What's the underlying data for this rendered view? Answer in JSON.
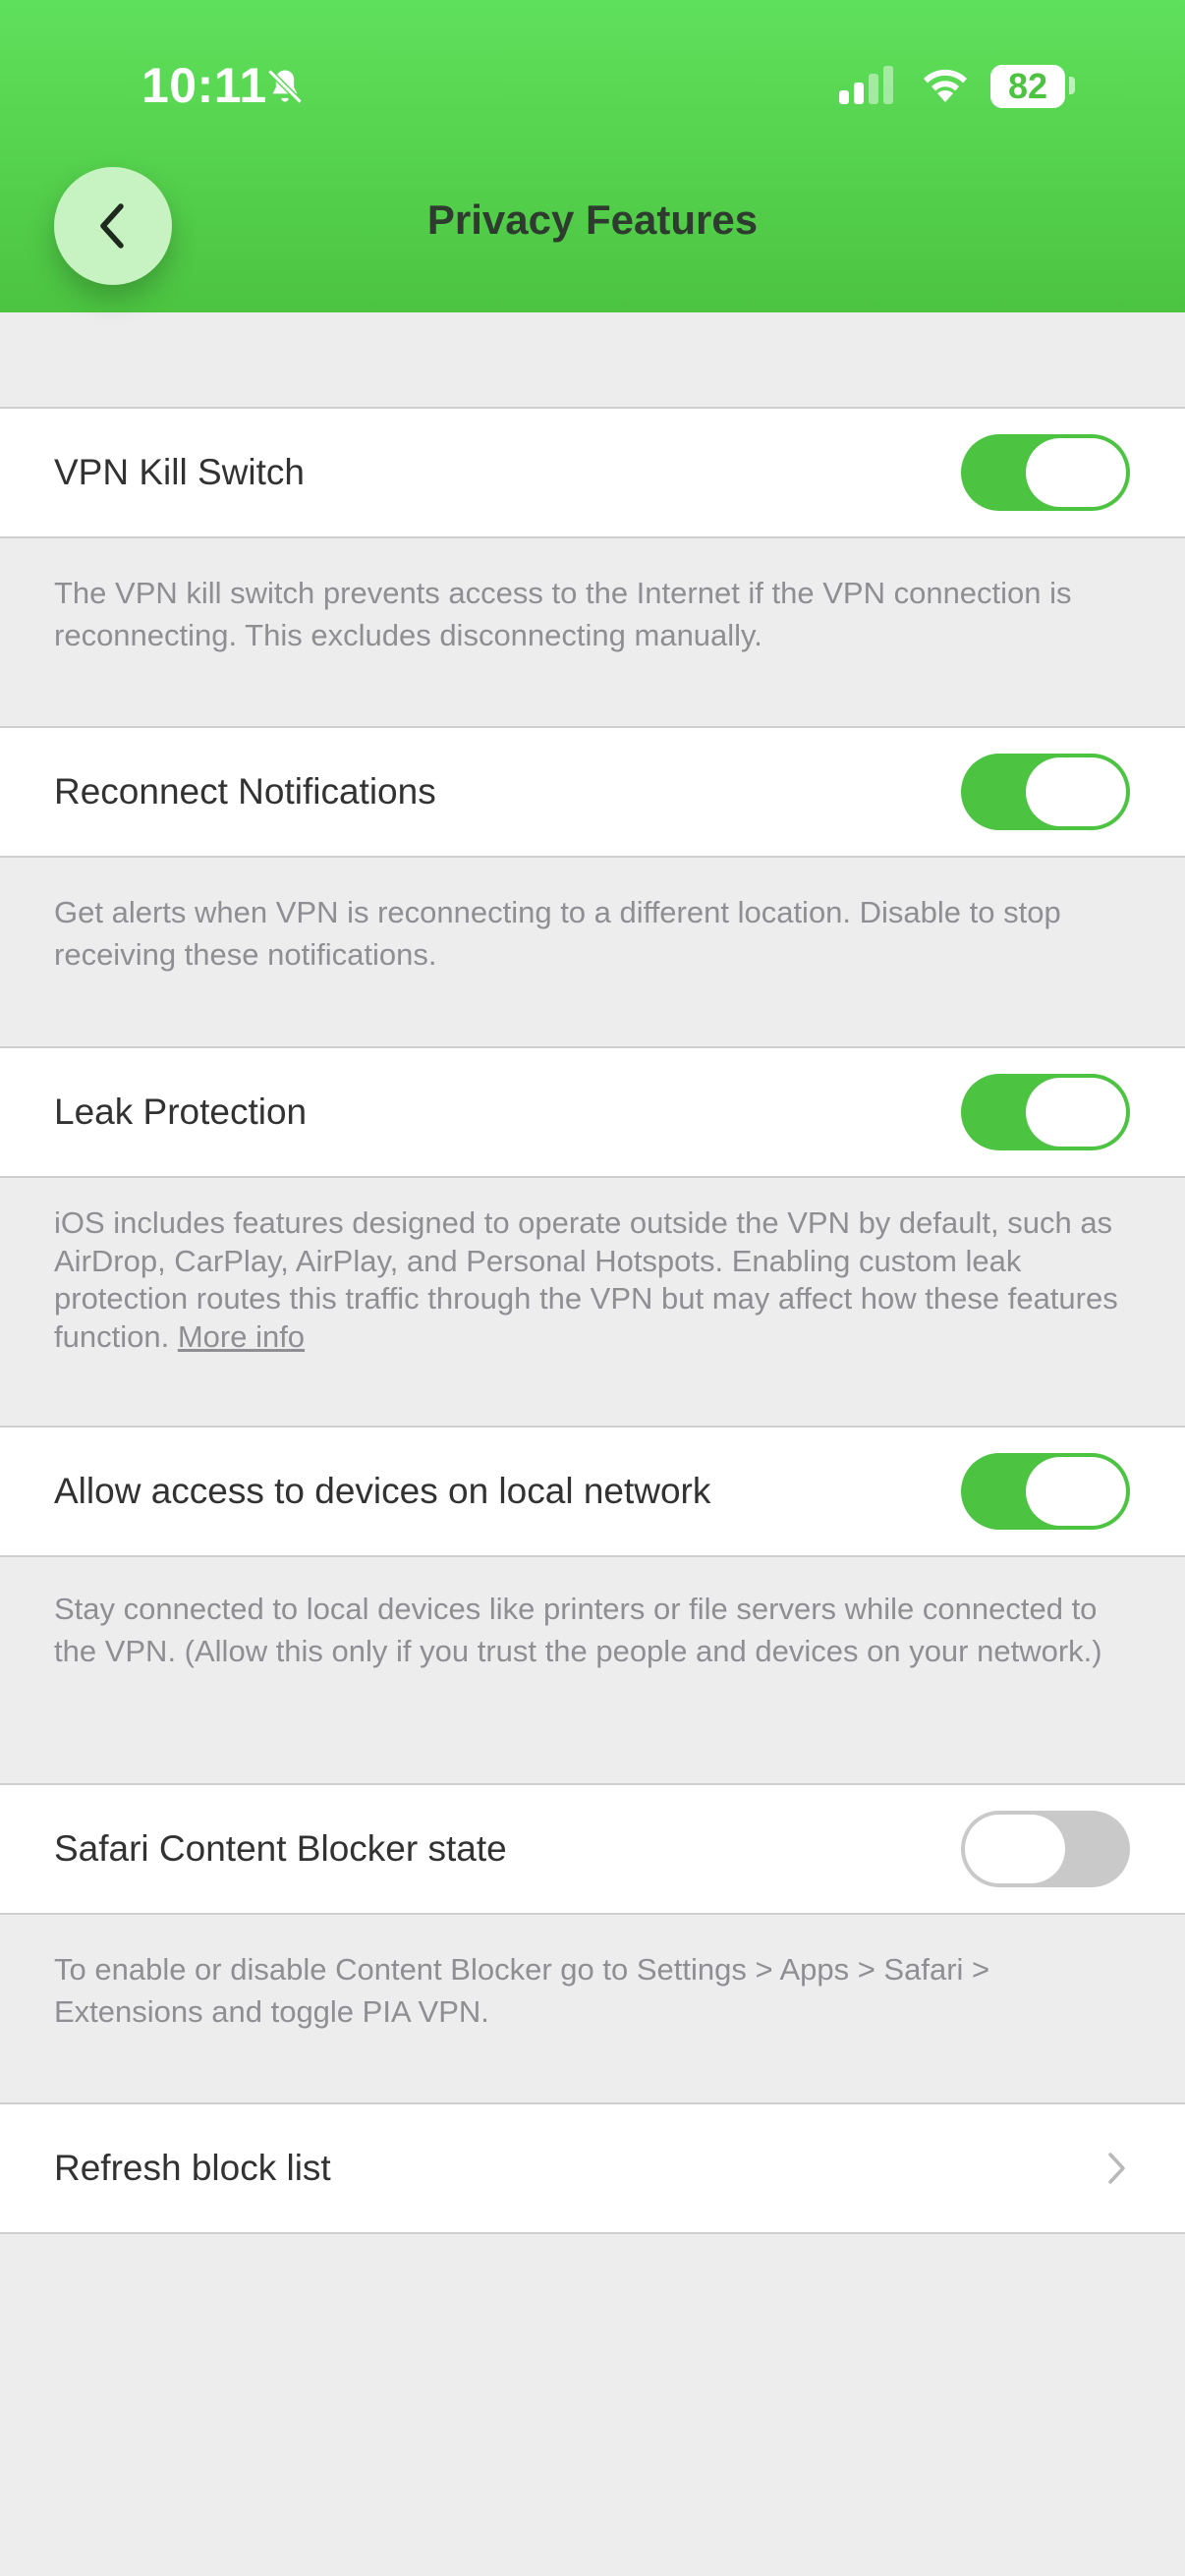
{
  "status_bar": {
    "time": "10:11",
    "battery": "82",
    "icons": [
      "bell-slash-icon",
      "cellular-signal-icon",
      "wifi-icon",
      "battery-icon"
    ]
  },
  "header": {
    "title": "Privacy Features",
    "back_icon": "chevron-left-icon",
    "color": "#4cc441"
  },
  "settings": [
    {
      "label": "VPN Kill Switch",
      "enabled": true,
      "description": "The VPN kill switch prevents access to the Internet if the VPN connection is reconnecting. This excludes disconnecting manually."
    },
    {
      "label": "Reconnect Notifications",
      "enabled": true,
      "description": "Get alerts when VPN is reconnecting to a different location. Disable to stop receiving these notifications."
    },
    {
      "label": "Leak Protection",
      "enabled": true,
      "description": "iOS includes features designed to operate outside the VPN by default, such as AirDrop, CarPlay, AirPlay, and Personal Hotspots. Enabling custom leak protection routes this traffic through the VPN but may affect how these features function.",
      "link": "More info"
    },
    {
      "label": "Allow access to devices on local network",
      "enabled": true,
      "description": "Stay connected to local devices like printers or file servers while connected to the VPN. (Allow this only if you trust the people and devices on your network.)"
    },
    {
      "label": "Safari Content Blocker state",
      "enabled": false,
      "description": "To enable or disable Content Blocker go to Settings > Apps > Safari > Extensions and toggle PIA VPN."
    }
  ],
  "refresh": {
    "label": "Refresh block list",
    "icon": "chevron-right-icon"
  },
  "colors": {
    "toggle_on": "#4cc441",
    "toggle_off": "#c9c9c9",
    "background": "#ededed"
  }
}
